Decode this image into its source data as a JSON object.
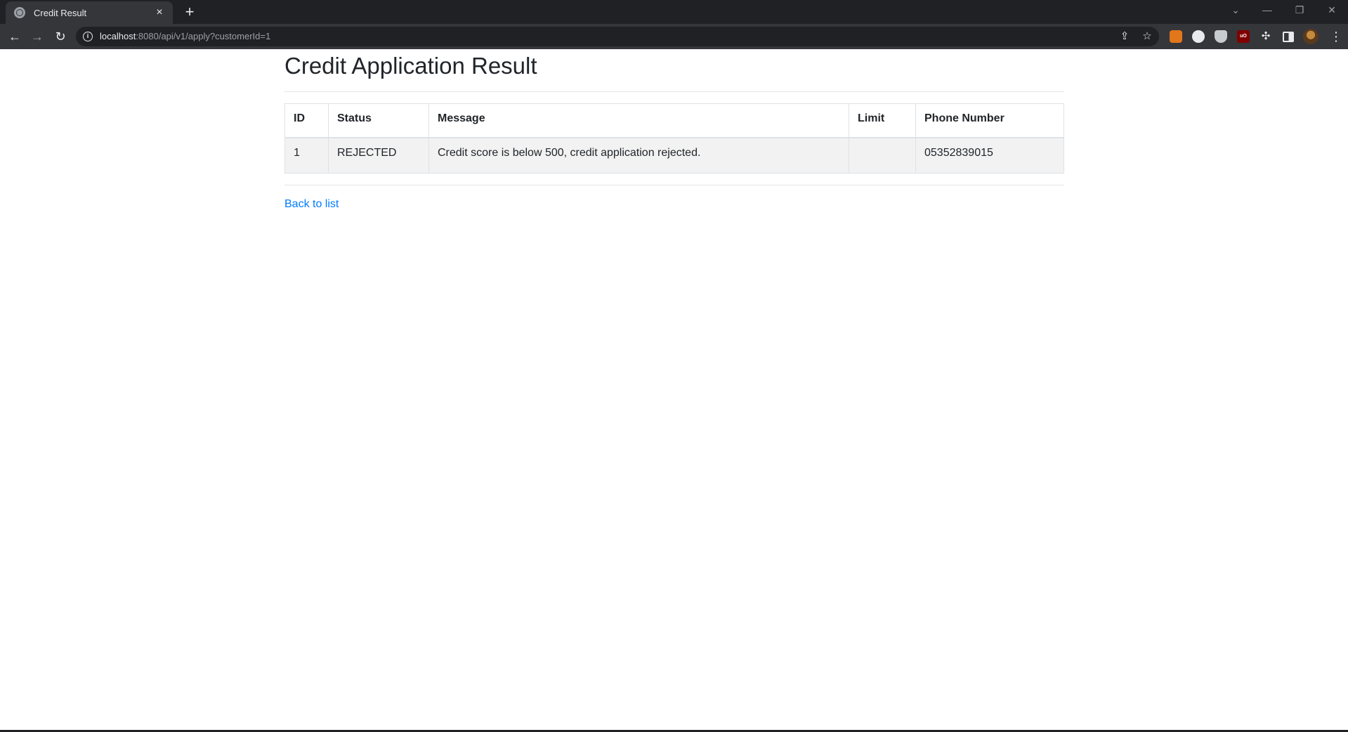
{
  "browser": {
    "tab_title": "Credit Result",
    "tab_close": "×",
    "new_tab": "+",
    "url_host": "localhost",
    "url_rest": ":8080/api/v1/apply?customerId=1",
    "icons": {
      "back": "arrow-left-icon",
      "forward": "arrow-right-icon",
      "reload": "reload-icon",
      "info": "info-icon",
      "share": "share-icon",
      "bookmark": "star-icon",
      "extensions": [
        "metamask-fox-icon",
        "circle-extension-icon",
        "shield-extension-icon",
        "ublock-icon",
        "puzzle-icon",
        "side-panel-icon",
        "profile-avatar-icon"
      ],
      "menu": "kebab-menu-icon"
    }
  },
  "page": {
    "title": "Credit Application Result",
    "table": {
      "columns": [
        "ID",
        "Status",
        "Message",
        "Limit",
        "Phone Number"
      ],
      "rows": [
        [
          "1",
          "REJECTED",
          "Credit score is below 500, credit application rejected.",
          "",
          "05352839015"
        ]
      ]
    },
    "back_link": "Back to list",
    "colors": {
      "link": "#007bff",
      "row_stripe": "#f2f2f2",
      "chrome_dark": "#202124",
      "chrome_toolbar": "#35363a"
    }
  }
}
